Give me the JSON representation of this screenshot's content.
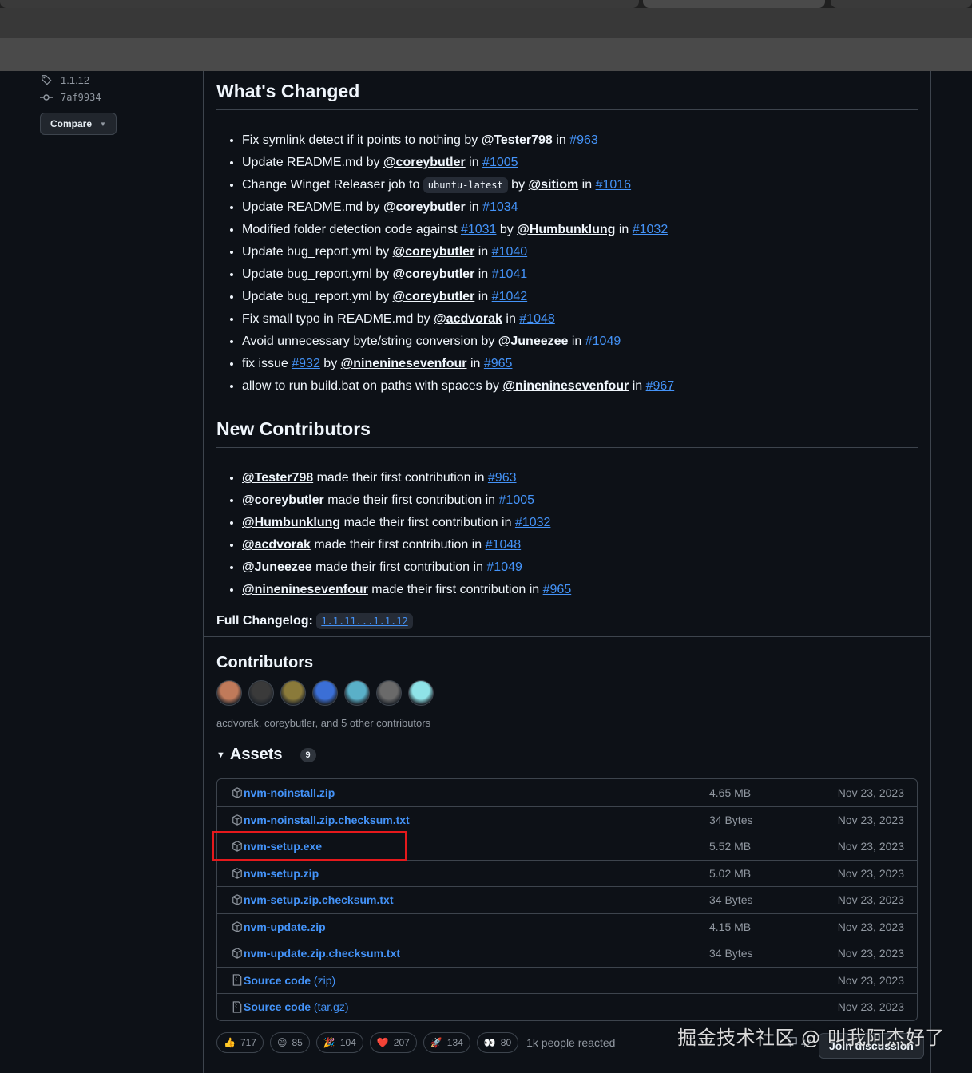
{
  "sidebar": {
    "tag": "1.1.12",
    "commit": "7af9934",
    "compare_label": "Compare"
  },
  "whats_changed": {
    "title": "What's Changed",
    "items": [
      {
        "pre": "Fix symlink detect if it points to nothing by ",
        "user": "@Tester798",
        "mid": " in ",
        "pr": "#963"
      },
      {
        "pre": "Update README.md by ",
        "user": "@coreybutler",
        "mid": " in ",
        "pr": "#1005"
      },
      {
        "pre": "Change Winget Releaser job to ",
        "code": "ubuntu-latest",
        "pre2": " by ",
        "user": "@sitiom",
        "mid": " in ",
        "pr": "#1016"
      },
      {
        "pre": "Update README.md by ",
        "user": "@coreybutler",
        "mid": " in ",
        "pr": "#1034"
      },
      {
        "pre": "Modified folder detection code against ",
        "pr0": "#1031",
        "pre2": " by ",
        "user": "@Humbunklung",
        "mid": " in ",
        "pr": "#1032"
      },
      {
        "pre": "Update bug_report.yml by ",
        "user": "@coreybutler",
        "mid": " in ",
        "pr": "#1040"
      },
      {
        "pre": "Update bug_report.yml by ",
        "user": "@coreybutler",
        "mid": " in ",
        "pr": "#1041"
      },
      {
        "pre": "Update bug_report.yml by ",
        "user": "@coreybutler",
        "mid": " in ",
        "pr": "#1042"
      },
      {
        "pre": "Fix small typo in README.md by ",
        "user": "@acdvorak",
        "mid": " in ",
        "pr": "#1048"
      },
      {
        "pre": "Avoid unnecessary byte/string conversion by ",
        "user": "@Juneezee",
        "mid": " in ",
        "pr": "#1049"
      },
      {
        "pre": "fix issue ",
        "pr0": "#932",
        "pre2": " by ",
        "user": "@nineninesevenfour",
        "mid": " in ",
        "pr": "#965"
      },
      {
        "pre": "allow to run build.bat on paths with spaces by ",
        "user": "@nineninesevenfour",
        "mid": " in ",
        "pr": "#967"
      }
    ]
  },
  "new_contributors": {
    "title": "New Contributors",
    "items": [
      {
        "user": "@Tester798",
        "text": " made their first contribution in ",
        "pr": "#963"
      },
      {
        "user": "@coreybutler",
        "text": " made their first contribution in ",
        "pr": "#1005"
      },
      {
        "user": "@Humbunklung",
        "text": " made their first contribution in ",
        "pr": "#1032"
      },
      {
        "user": "@acdvorak",
        "text": " made their first contribution in ",
        "pr": "#1048"
      },
      {
        "user": "@Juneezee",
        "text": " made their first contribution in ",
        "pr": "#1049"
      },
      {
        "user": "@nineninesevenfour",
        "text": " made their first contribution in ",
        "pr": "#965"
      }
    ],
    "changelog_label": "Full Changelog:",
    "changelog_link": "1.1.11...1.1.12"
  },
  "contributors": {
    "title": "Contributors",
    "summary": "acdvorak, coreybutler, and 5 other contributors",
    "avatar_colors": [
      "#c07a5a",
      "#3a3a3a",
      "#8a7a3a",
      "#3b6fd6",
      "#5ab0c8",
      "#6a6a6a",
      "#8fe3e8"
    ]
  },
  "assets": {
    "title": "Assets",
    "count": "9",
    "rows": [
      {
        "name": "nvm-noinstall.zip",
        "size": "4.65 MB",
        "date": "Nov 23, 2023",
        "icon": "package-icon"
      },
      {
        "name": "nvm-noinstall.zip.checksum.txt",
        "size": "34 Bytes",
        "date": "Nov 23, 2023",
        "icon": "package-icon"
      },
      {
        "name": "nvm-setup.exe",
        "size": "5.52 MB",
        "date": "Nov 23, 2023",
        "icon": "package-icon"
      },
      {
        "name": "nvm-setup.zip",
        "size": "5.02 MB",
        "date": "Nov 23, 2023",
        "icon": "package-icon"
      },
      {
        "name": "nvm-setup.zip.checksum.txt",
        "size": "34 Bytes",
        "date": "Nov 23, 2023",
        "icon": "package-icon"
      },
      {
        "name": "nvm-update.zip",
        "size": "4.15 MB",
        "date": "Nov 23, 2023",
        "icon": "package-icon"
      },
      {
        "name": "nvm-update.zip.checksum.txt",
        "size": "34 Bytes",
        "date": "Nov 23, 2023",
        "icon": "package-icon"
      },
      {
        "name_bold": "Source code",
        "name_rest": " (zip)",
        "size": "",
        "date": "Nov 23, 2023",
        "icon": "file-zip-icon"
      },
      {
        "name_bold": "Source code",
        "name_rest": " (tar.gz)",
        "size": "",
        "date": "Nov 23, 2023",
        "icon": "file-zip-icon"
      }
    ]
  },
  "reactions": {
    "items": [
      {
        "emoji": "👍",
        "count": "717"
      },
      {
        "emoji": "😄",
        "count": "85"
      },
      {
        "emoji": "🎉",
        "count": "104"
      },
      {
        "emoji": "❤️",
        "count": "207"
      },
      {
        "emoji": "🚀",
        "count": "134"
      },
      {
        "emoji": "👀",
        "count": "80"
      }
    ],
    "summary": "1k people reacted",
    "discussion_count": "42",
    "join_label": "Join discussion"
  },
  "watermark": "掘金技术社区 @ 叫我阿杰好了",
  "colors": {
    "accent": "#4493f8",
    "highlight": "#e5191c",
    "background": "#0d1117"
  }
}
